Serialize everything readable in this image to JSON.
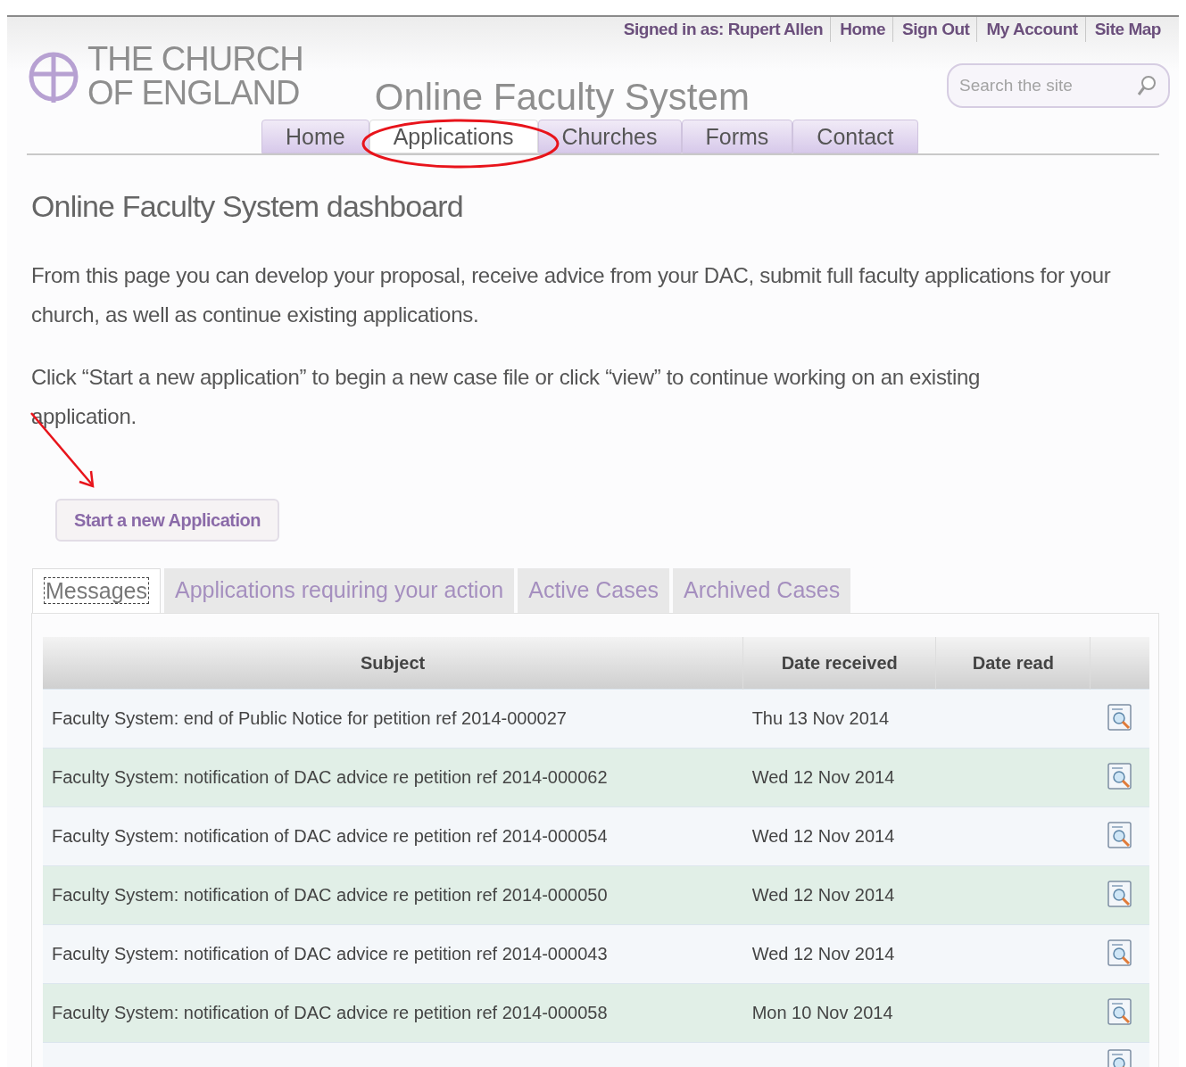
{
  "header": {
    "signed_in": "Signed in as: Rupert Allen",
    "links": [
      "Home",
      "Sign Out",
      "My Account",
      "Site Map"
    ],
    "logo_lines": [
      "THE CHURCH",
      "OF ENGLAND"
    ],
    "site_title": "Online Faculty System",
    "search": {
      "placeholder": "Search the site"
    }
  },
  "nav": [
    {
      "label": "Home",
      "selected": false
    },
    {
      "label": "Applications",
      "selected": true
    },
    {
      "label": "Churches",
      "selected": false
    },
    {
      "label": "Forms",
      "selected": false
    },
    {
      "label": "Contact",
      "selected": false
    }
  ],
  "heading": "Online Faculty System dashboard",
  "paragraphs": [
    "From this page you can develop your proposal, receive advice from your DAC, submit full faculty applications for your church, as well as continue existing applications.",
    "Click “Start a new application” to begin a new case file or click “view” to continue working on an existing application."
  ],
  "start_button": "Start a new Application",
  "tabs": [
    {
      "label": "Messages",
      "selected": true
    },
    {
      "label": "Applications requiring your action",
      "selected": false
    },
    {
      "label": "Active Cases",
      "selected": false
    },
    {
      "label": "Archived Cases",
      "selected": false
    }
  ],
  "table": {
    "columns": [
      "Subject",
      "Date received",
      "Date read"
    ],
    "rows": [
      {
        "subject": "Faculty System: end of Public Notice for petition ref 2014-000027",
        "date_received": "Thu 13 Nov 2014"
      },
      {
        "subject": "Faculty System: notification of DAC advice re petition ref 2014-000062",
        "date_received": "Wed 12 Nov 2014"
      },
      {
        "subject": "Faculty System: notification of DAC advice re petition ref 2014-000054",
        "date_received": "Wed 12 Nov 2014"
      },
      {
        "subject": "Faculty System: notification of DAC advice re petition ref 2014-000050",
        "date_received": "Wed 12 Nov 2014"
      },
      {
        "subject": "Faculty System: notification of DAC advice re petition ref 2014-000043",
        "date_received": "Wed 12 Nov 2014"
      },
      {
        "subject": "Faculty System: notification of DAC advice re petition ref 2014-000058",
        "date_received": "Mon 10 Nov 2014"
      }
    ]
  }
}
